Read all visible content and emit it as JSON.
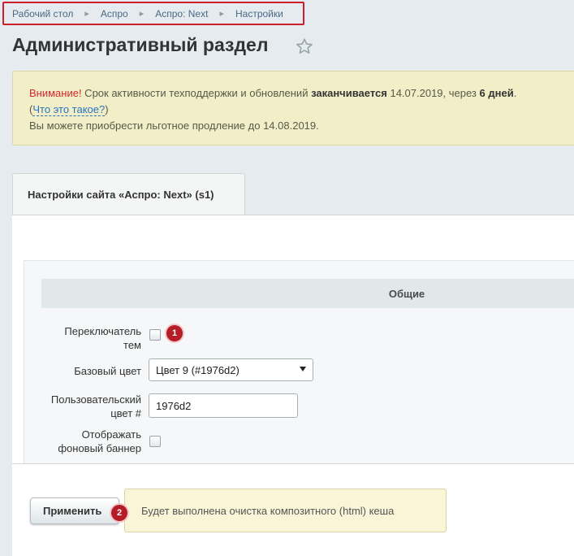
{
  "breadcrumbs": [
    "Рабочий стол",
    "Аспро",
    "Аспро: Next",
    "Настройки"
  ],
  "page_title": "Административный раздел",
  "warning": {
    "attention": "Внимание!",
    "text1": " Срок активности техподдержки и обновлений ",
    "bold1": "заканчивается",
    "text2": " 14.07.2019, через ",
    "bold2": "6 дней",
    "text3": ".",
    "paren_open": "(",
    "link": "Что это такое?",
    "paren_close": ")",
    "line3": "Вы можете приобрести льготное продление до 14.08.2019."
  },
  "tab": {
    "label": "Настройки сайта «Аспро: Next» (s1)"
  },
  "section": {
    "title": "Общие"
  },
  "fields": {
    "theme_switcher": {
      "label_line1": "Переключатель",
      "label_line2": "тем",
      "checked": false
    },
    "base_color": {
      "label": "Базовый цвет",
      "value": "Цвет 9 (#1976d2)"
    },
    "custom_color": {
      "label_line1": "Пользовательский",
      "label_line2": "цвет #",
      "value": "1976d2"
    },
    "bg_banner": {
      "label_line1": "Отображать",
      "label_line2": "фоновый баннер",
      "checked": false
    }
  },
  "badges": {
    "one": "1",
    "two": "2"
  },
  "apply_button": "Применить",
  "hint": "Будет выполнена очистка композитного (html) кеша",
  "colors": {
    "accent_red": "#cc1f2a",
    "link_blue": "#2574c0",
    "warning_bg": "#f2efc8"
  },
  "icons": {
    "favorite": "star-icon",
    "dropdown": "chevron-down-icon"
  }
}
